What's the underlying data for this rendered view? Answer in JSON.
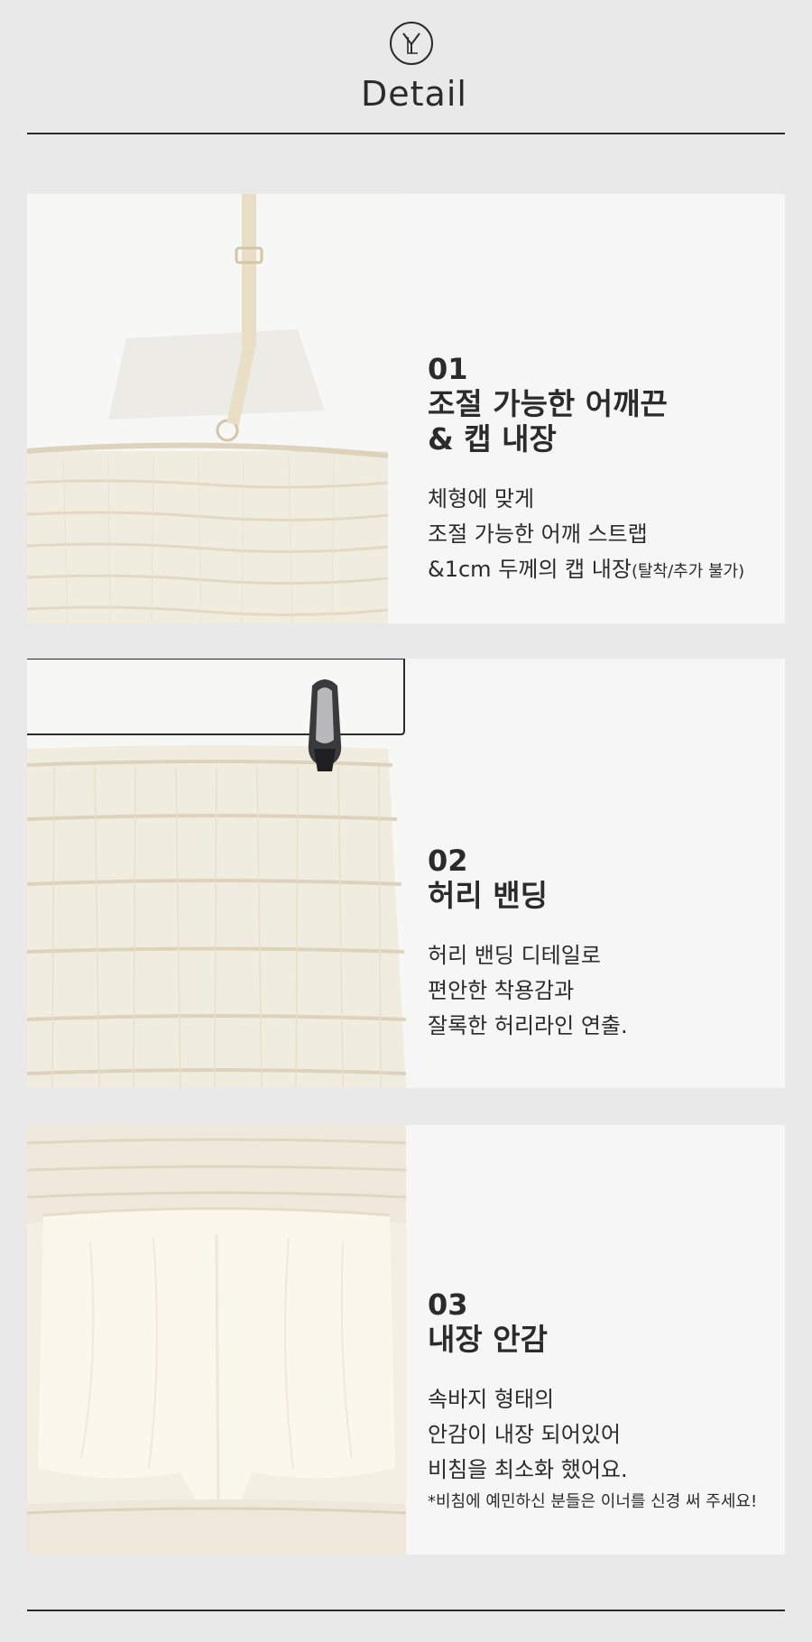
{
  "header": {
    "logo_text": "YL",
    "title": "Detail"
  },
  "sections": [
    {
      "number": "01",
      "title_lines": [
        "조절 가능한 어깨끈",
        "& 캡 내장"
      ],
      "desc_lines": [
        "체형에 맞게",
        "조절 가능한 어깨 스트랩",
        "&1cm 두께의 캡 내장"
      ],
      "desc_suffix": "(탈착/추가 불가)"
    },
    {
      "number": "02",
      "title_lines": [
        "허리 밴딩"
      ],
      "desc_lines": [
        "허리 밴딩 디테일로",
        "편안한 착용감과",
        "잘록한 허리라인 연출."
      ]
    },
    {
      "number": "03",
      "title_lines": [
        "내장 안감"
      ],
      "desc_lines": [
        "속바지 형태의",
        "안감이 내장 되어있어",
        "비침을 최소화 했어요."
      ],
      "note": "*비침에 예민하신 분들은 이너를 신경 써 주세요!"
    }
  ],
  "colors": {
    "background": "#e9e9e9",
    "panel": "#f6f6f6",
    "text": "#2b2b2b",
    "fabric": "#f3efe3"
  }
}
